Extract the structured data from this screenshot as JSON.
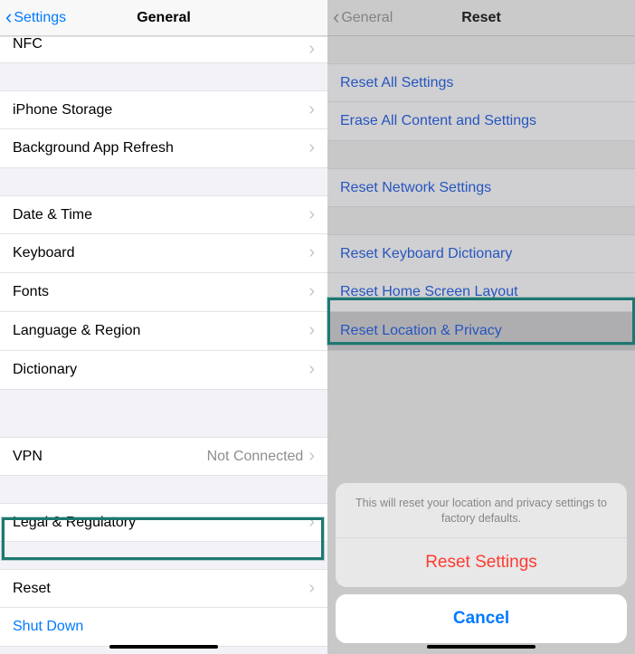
{
  "left": {
    "nav": {
      "back": "Settings",
      "title": "General"
    },
    "rows": {
      "nfc": "NFC",
      "iphone_storage": "iPhone Storage",
      "bg_app_refresh": "Background App Refresh",
      "date_time": "Date & Time",
      "keyboard": "Keyboard",
      "fonts": "Fonts",
      "lang_region": "Language & Region",
      "dictionary": "Dictionary",
      "vpn": "VPN",
      "vpn_value": "Not Connected",
      "legal": "Legal & Regulatory",
      "reset": "Reset",
      "shutdown": "Shut Down"
    }
  },
  "right": {
    "nav": {
      "back": "General",
      "title": "Reset"
    },
    "rows": {
      "reset_all": "Reset All Settings",
      "erase_all": "Erase All Content and Settings",
      "reset_network": "Reset Network Settings",
      "reset_keyboard": "Reset Keyboard Dictionary",
      "reset_home": "Reset Home Screen Layout",
      "reset_location": "Reset Location & Privacy"
    },
    "sheet": {
      "message": "This will reset your location and privacy settings to factory defaults.",
      "reset_btn": "Reset Settings",
      "cancel_btn": "Cancel"
    }
  }
}
